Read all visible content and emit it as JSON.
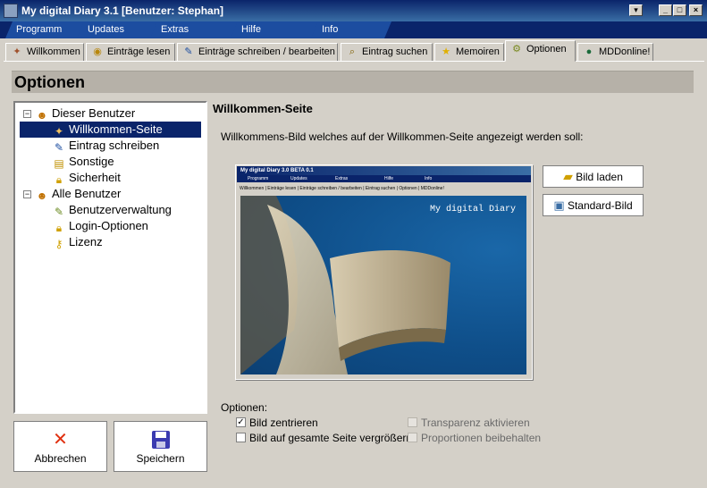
{
  "window": {
    "title": "My digital Diary 3.1   [Benutzer: Stephan]",
    "controls": {
      "dropdown": "▾",
      "minimize": "_",
      "maximize": "□",
      "close": "×"
    }
  },
  "menu": [
    "Programm",
    "Updates",
    "Extras",
    "Hilfe",
    "Info"
  ],
  "tabs": [
    {
      "label": "Willkommen",
      "icon": "wand-icon"
    },
    {
      "label": "Einträge lesen",
      "icon": "eye-icon"
    },
    {
      "label": "Einträge schreiben / bearbeiten",
      "icon": "pencil-icon"
    },
    {
      "label": "Eintrag suchen",
      "icon": "magnifier-icon"
    },
    {
      "label": "Memoiren",
      "icon": "star-icon"
    },
    {
      "label": "Optionen",
      "icon": "gears-icon",
      "active": true
    },
    {
      "label": "MDDonline!",
      "icon": "globe-icon"
    }
  ],
  "page_title": "Optionen",
  "tree": {
    "group1": {
      "label": "Dieser Benutzer",
      "expander": "−"
    },
    "group1_items": [
      "Willkommen-Seite",
      "Eintrag schreiben",
      "Sonstige",
      "Sicherheit"
    ],
    "group2": {
      "label": "Alle Benutzer",
      "expander": "−"
    },
    "group2_items": [
      "Benutzerverwaltung",
      "Login-Optionen",
      "Lizenz"
    ],
    "selected": "Willkommen-Seite"
  },
  "buttons": {
    "cancel": "Abbrechen",
    "save": "Speichern",
    "load_image": "Bild laden",
    "default_image": "Standard-Bild"
  },
  "content": {
    "title": "Willkommen-Seite",
    "description": "Willkommens-Bild welches auf der Willkommen-Seite angezeigt werden soll:",
    "preview": {
      "title": "My digital Diary 3.0 BETA 0.1",
      "menu": [
        "Programm",
        "Updates",
        "Extras",
        "Hilfe",
        "Info"
      ],
      "tabs": "Willkommen | Einträge lesen | Einträge schreiben / bearbeiten | Eintrag suchen | Optionen | MDDonline!",
      "image_text": "My digital Diary"
    },
    "options_label": "Optionen:",
    "options": [
      {
        "label": "Bild zentrieren",
        "checked": true,
        "enabled": true,
        "mark": "✓"
      },
      {
        "label": "Bild auf gesamte Seite vergrößern",
        "checked": false,
        "enabled": true,
        "mark": ""
      },
      {
        "label": "Transparenz aktivieren",
        "checked": false,
        "enabled": false,
        "mark": ""
      },
      {
        "label": "Proportionen beibehalten",
        "checked": false,
        "enabled": false,
        "mark": ""
      }
    ]
  },
  "colors": {
    "title_bar": "#0a246a",
    "selection": "#0a246a",
    "header_bar": "#b6b1a8",
    "preview_sky": "#0f4f8a"
  }
}
